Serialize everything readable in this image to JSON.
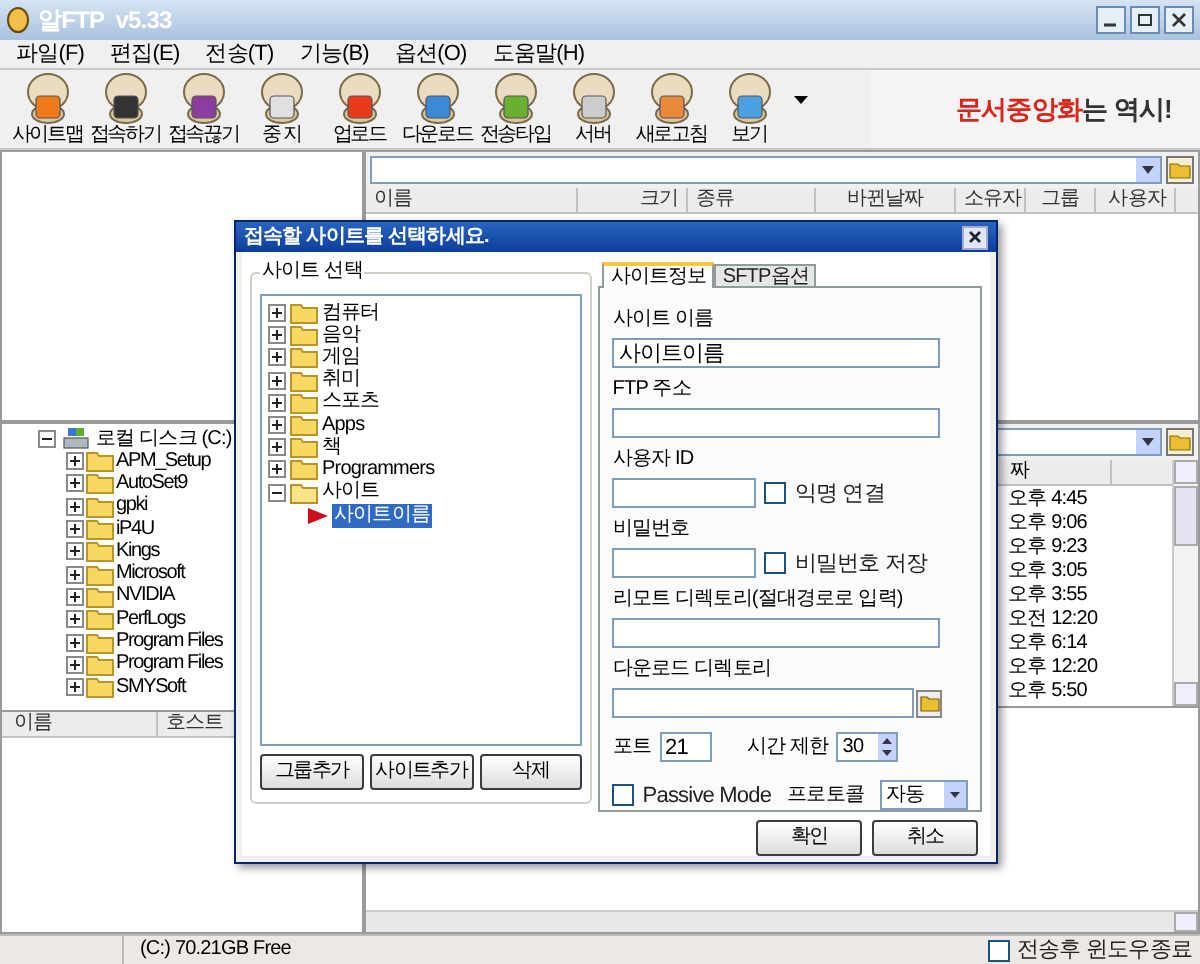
{
  "window": {
    "title": "알FTP  v5.33"
  },
  "menu": [
    "파일(F)",
    "편집(E)",
    "전송(T)",
    "기능(B)",
    "옵션(O)",
    "도움말(H)"
  ],
  "toolbar": [
    "사이트맵",
    "접속하기",
    "접속끊기",
    "중 지",
    "업로드",
    "다운로드",
    "전송타입",
    "서버",
    "새로고침",
    "보기"
  ],
  "ad": {
    "highlight": "문서중앙화",
    "rest": "는 역시!"
  },
  "remote": {
    "columns": [
      "이름",
      "크기",
      "종류",
      "바뀐날짜",
      "소유자",
      "그룹",
      "사용자"
    ]
  },
  "local": {
    "root": "로컬 디스크 (C:)",
    "expanded": true,
    "children": [
      {
        "name": "APM_Setup",
        "expanded": false
      },
      {
        "name": "AutoSet9",
        "expanded": false
      },
      {
        "name": "gpki",
        "expanded": false
      },
      {
        "name": "iP4U",
        "expanded": false
      },
      {
        "name": "Kings",
        "expanded": false
      },
      {
        "name": "Microsoft",
        "expanded": false
      },
      {
        "name": "NVIDIA",
        "expanded": false
      },
      {
        "name": "PerfLogs",
        "expanded": false
      },
      {
        "name": "Program Files",
        "expanded": false
      },
      {
        "name": "Program Files",
        "expanded": false
      },
      {
        "name": "SMYSoft",
        "expanded": false
      }
    ],
    "list_columns": [
      "이름",
      "호스트"
    ]
  },
  "remote_lower": {
    "column": "짜",
    "times": [
      "오후 4:45",
      "오후 9:06",
      "오후 9:23",
      "오후 3:05",
      "오후 3:55",
      "오전 12:20",
      "오후 6:14",
      "오후 12:20",
      "오후 5:50"
    ]
  },
  "status_bar": {
    "drive": "(C:) 70.21GB Free",
    "close_after": {
      "label": "전송후 윈도우종료",
      "checked": false
    }
  },
  "dialog": {
    "title": "접속할 사이트를 선택하세요.",
    "group_label": "사이트 선택",
    "tree": [
      {
        "name": "컴퓨터",
        "expanded": false
      },
      {
        "name": "음악",
        "expanded": false
      },
      {
        "name": "게임",
        "expanded": false
      },
      {
        "name": "취미",
        "expanded": false
      },
      {
        "name": "스포츠",
        "expanded": false
      },
      {
        "name": "Apps",
        "expanded": false
      },
      {
        "name": "책",
        "expanded": false
      },
      {
        "name": "Programmers",
        "expanded": false
      },
      {
        "name": "사이트",
        "expanded": true,
        "children": [
          {
            "name": "사이트이름",
            "selected": true
          }
        ]
      }
    ],
    "buttons": [
      "그룹추가",
      "사이트추가",
      "삭제"
    ],
    "tabs": [
      {
        "label": "사이트정보",
        "selected": true
      },
      {
        "label": "SFTP옵션",
        "selected": false
      }
    ],
    "site_name": {
      "label": "사이트 이름",
      "value": "사이트이름"
    },
    "ftp_address": {
      "label": "FTP 주소"
    },
    "user_id": {
      "label": "사용자 ID"
    },
    "anonymous": {
      "label": "익명 연결",
      "checked": false
    },
    "password": {
      "label": "비밀번호"
    },
    "save_password": {
      "label": "비밀번호 저장",
      "checked": false
    },
    "remote_dir": {
      "label": "리모트 디렉토리(절대경로로 입력)"
    },
    "download_dir": {
      "label": "다운로드 디렉토리"
    },
    "port": {
      "label": "포트",
      "value": "21"
    },
    "timeout": {
      "label": "시간 제한",
      "value": "30"
    },
    "passive": {
      "label": "Passive Mode",
      "checked": false
    },
    "protocol": {
      "label": "프로토콜",
      "value": "자동"
    },
    "ok": "확인",
    "cancel": "취소"
  }
}
